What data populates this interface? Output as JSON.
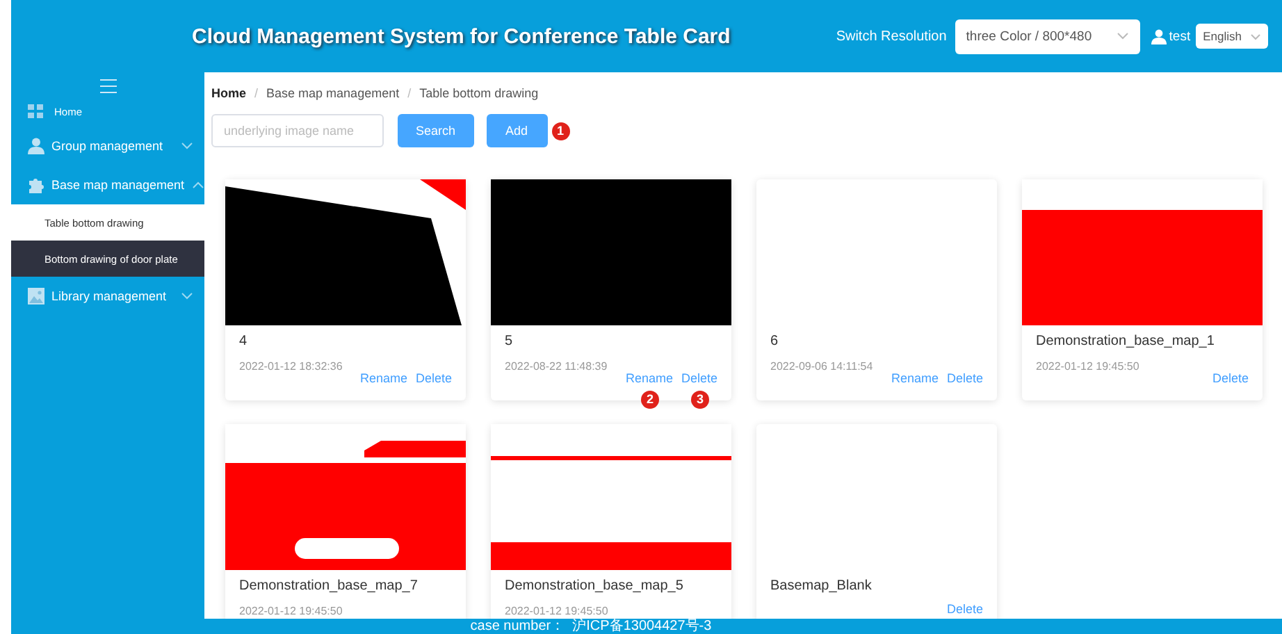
{
  "header": {
    "title": "Cloud Management System for Conference Table Card",
    "resolution_label": "Switch Resolution",
    "resolution_value": "three Color / 800*480",
    "user": "test",
    "language": "English"
  },
  "sidebar": {
    "items": [
      {
        "label": "Home"
      },
      {
        "label": "Group management",
        "expanded": false
      },
      {
        "label": "Base map management",
        "expanded": true,
        "children": [
          {
            "label": "Table bottom drawing",
            "selected": true
          },
          {
            "label": "Bottom drawing of door plate",
            "selected": false
          }
        ]
      },
      {
        "label": "Library management",
        "expanded": false
      }
    ]
  },
  "breadcrumb": [
    {
      "label": "Home",
      "current": false
    },
    {
      "separator": "/",
      "label": "Base map management",
      "current": true
    },
    {
      "separator": "/",
      "label": "Table bottom drawing",
      "current": true
    }
  ],
  "toolbar": {
    "search": {
      "placeholder": "underlying image name"
    },
    "buttons": [
      {
        "label": "Search"
      },
      {
        "label": "Add",
        "marker": "1"
      }
    ]
  },
  "cards": [
    {
      "title": "4",
      "date": "2022-01-12 18:32:36",
      "actions": [
        {
          "label": "Rename"
        },
        {
          "label": "Delete"
        }
      ]
    },
    {
      "title": "5",
      "date": "2022-08-22 11:48:39",
      "actions": [
        {
          "label": "Rename",
          "marker": "2"
        },
        {
          "label": "Delete",
          "marker": "3"
        }
      ]
    },
    {
      "title": "6",
      "date": "2022-09-06 14:11:54",
      "actions": [
        {
          "label": "Rename"
        },
        {
          "label": "Delete"
        }
      ]
    },
    {
      "title": "Demonstration_base_map_1",
      "date": "2022-01-12 19:45:50",
      "actions": [
        {
          "label": "Delete"
        }
      ]
    },
    {
      "title": "Demonstration_base_map_7",
      "date": "2022-01-12 19:45:50"
    },
    {
      "title": "Demonstration_base_map_5",
      "date": "2022-01-12 19:45:50"
    },
    {
      "title": "Basemap_Blank",
      "actions": [
        {
          "label": "Delete"
        }
      ]
    }
  ],
  "footer": {
    "text": "case number：  沪ICP备13004427号-3"
  }
}
